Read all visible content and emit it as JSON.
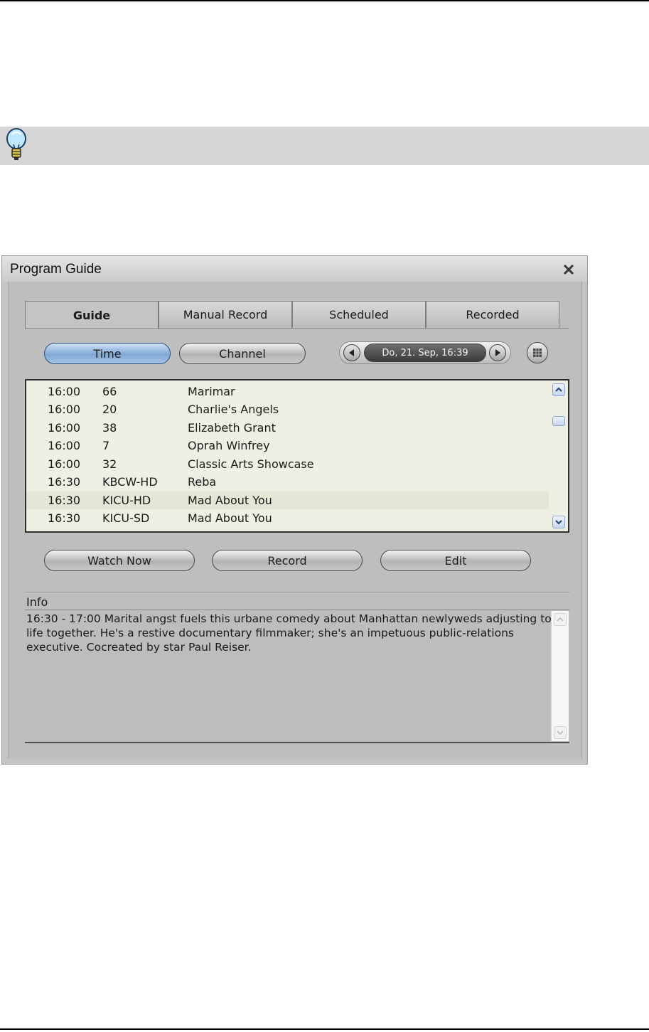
{
  "window": {
    "title": "Program Guide",
    "close_icon": "close-icon"
  },
  "tabs": [
    {
      "label": "Guide",
      "active": true
    },
    {
      "label": "Manual Record",
      "active": false
    },
    {
      "label": "Scheduled",
      "active": false
    },
    {
      "label": "Recorded",
      "active": false
    }
  ],
  "view_toggle": {
    "time_label": "Time",
    "channel_label": "Channel",
    "selected": "Time"
  },
  "date_nav": {
    "date_text": "Do, 21. Sep, 16:39",
    "prev_icon": "triangle-left-icon",
    "next_icon": "triangle-right-icon",
    "calendar_icon": "calendar-icon"
  },
  "program_list": {
    "rows": [
      {
        "time": "16:00",
        "channel": "66",
        "title": "Marimar"
      },
      {
        "time": "16:00",
        "channel": "20",
        "title": "Charlie's Angels"
      },
      {
        "time": "16:00",
        "channel": "38",
        "title": "Elizabeth Grant"
      },
      {
        "time": "16:00",
        "channel": "7",
        "title": "Oprah Winfrey"
      },
      {
        "time": "16:00",
        "channel": "32",
        "title": "Classic Arts Showcase"
      },
      {
        "time": "16:30",
        "channel": "KBCW-HD",
        "title": "Reba"
      },
      {
        "time": "16:30",
        "channel": "KICU-HD",
        "title": "Mad About You"
      },
      {
        "time": "16:30",
        "channel": "KICU-SD",
        "title": "Mad About You"
      }
    ],
    "selected_index": 6
  },
  "actions": {
    "watch_now_label": "Watch Now",
    "record_label": "Record",
    "edit_label": "Edit"
  },
  "info": {
    "label": "Info",
    "text": "16:30 - 17:00  Marital angst fuels this urbane comedy about Manhattan newlyweds adjusting to life together. He's a restive documentary filmmaker; she's an impetuous public-relations executive. Cocreated by star Paul Reiser."
  },
  "tip_icon": "lightbulb-icon",
  "colors": {
    "selected_pill": "#7fa8d6",
    "list_background": "#efefe4",
    "window_background": "#c4c4c4"
  }
}
